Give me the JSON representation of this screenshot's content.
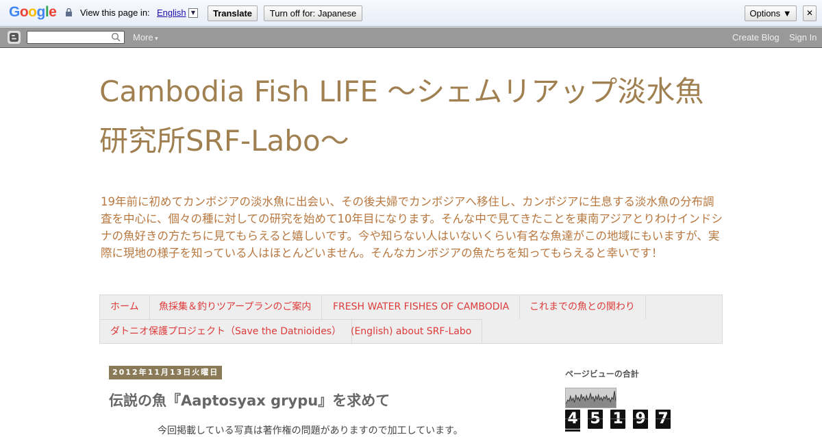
{
  "translate_bar": {
    "logo_letters": [
      {
        "ch": "G",
        "color": "#4285f4"
      },
      {
        "ch": "o",
        "color": "#ea4335"
      },
      {
        "ch": "o",
        "color": "#fbbc05"
      },
      {
        "ch": "g",
        "color": "#4285f4"
      },
      {
        "ch": "l",
        "color": "#34a853"
      },
      {
        "ch": "e",
        "color": "#ea4335"
      }
    ],
    "view_label": "View this page in:",
    "language": "English",
    "translate_label": "Translate",
    "turn_off_label": "Turn off for: Japanese",
    "options_label": "Options ▼",
    "close_label": "✕"
  },
  "navbar": {
    "more_label": "More",
    "create_blog_label": "Create Blog",
    "sign_in_label": "Sign In"
  },
  "header": {
    "title": "Cambodia Fish LIFE ～シェムリアップ淡水魚研究所SRF-Labo～",
    "description": "19年前に初めてカンボジアの淡水魚に出会い、その後夫婦でカンボジアへ移住し、カンボジアに生息する淡水魚の分布調査を中心に、個々の種に対しての研究を始めて10年目になります。そんな中で見てきたことを東南アジアとりわけインドシナの魚好きの方たちに見てもらえると嬉しいです。今や知らない人はいないくらい有名な魚達がこの地域にもいますが、実際に現地の様子を知っている人はほとんどいません。そんなカンボジアの魚たちを知ってもらえると幸いです！"
  },
  "tabs": [
    {
      "label": "ホーム"
    },
    {
      "label": "魚採集＆釣りツアープランのご案内"
    },
    {
      "label": "FRESH WATER FISHES OF CAMBODIA"
    },
    {
      "label": "これまでの魚との関わり"
    },
    {
      "label": "ダトニオ保護プロジェクト（Save the Datnioides）"
    },
    {
      "label": "(English) about SRF-Labo"
    }
  ],
  "post": {
    "date": "2012年11月13日火曜日",
    "title": "伝説の魚『Aaptosyax grypu』を求めて",
    "body_first_line": "今回掲載している写真は著作権の問題がありますので加工しています。"
  },
  "sidebar": {
    "pageviews_heading": "ページビューの合計",
    "counter_digits": [
      "4",
      "5",
      "1",
      "9",
      "7"
    ]
  },
  "colors": {
    "title": "#a08050",
    "description": "#b8773f",
    "tab_link": "#dd3a3a",
    "date_bg": "#8a7a57"
  }
}
